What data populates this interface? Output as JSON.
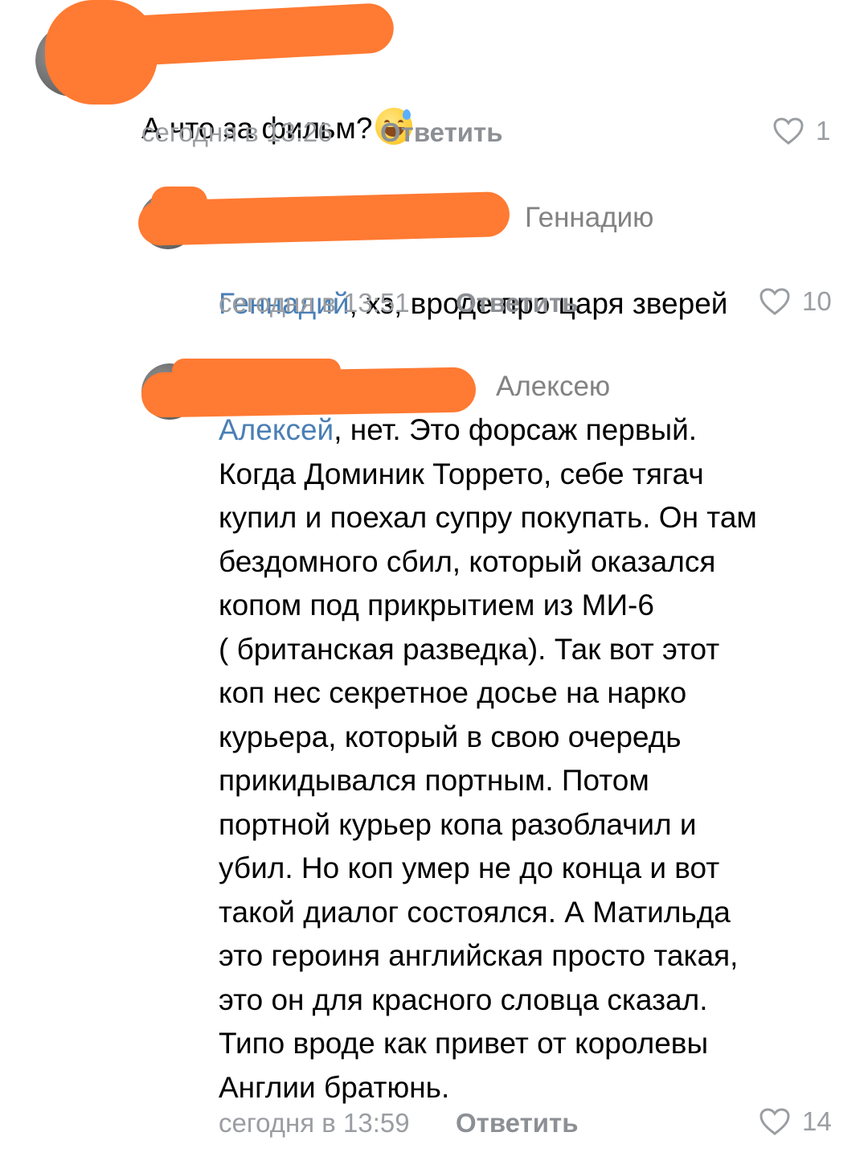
{
  "comments": [
    {
      "reply_to": "",
      "mention": "",
      "text": "А что за фильм?",
      "emoji": "grinning-sweat-emoji",
      "time": "сегодня в 13:26",
      "reply_label": "Ответить",
      "likes": "1"
    },
    {
      "reply_to": "Геннадию",
      "mention": "Геннадий",
      "text": ", хз, вроде про царя зверей",
      "time": "сегодня в 13:51",
      "reply_label": "Ответить",
      "likes": "10"
    },
    {
      "reply_to": "Алексею",
      "mention": "Алексей",
      "text": ", нет. Это форсаж первый.\nКогда Доминик Торрето, себе тягач\nкупил и поехал супру покупать. Он там\nбездомного сбил, который оказался\nкопом под прикрытием из МИ-6\n( британская разведка). Так вот этот\nкоп нес секретное досье на нарко\nкурьера, который в свою очередь\nприкидывался портным. Потом\nпортной курьер копа разоблачил и\nубил. Но коп умер не до конца и вот\nтакой диалог состоялся. А Матильда\nэто героиня английская просто такая,\nэто он для красного словца сказал.\nТипо вроде как привет от королевы\nАнглии братюнь.",
      "time": "сегодня в 13:59",
      "reply_label": "Ответить",
      "likes": "14"
    }
  ],
  "colors": {
    "redaction": "#ff7a32",
    "mention": "#4a7fb5",
    "meta": "#9a9da1"
  }
}
